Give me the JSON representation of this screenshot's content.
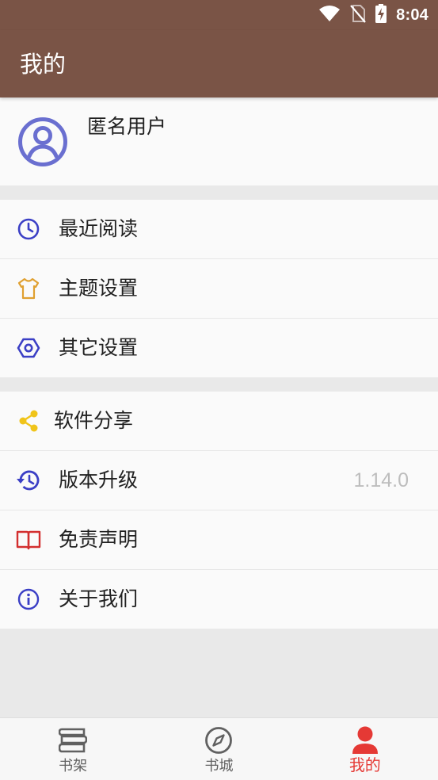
{
  "status_bar": {
    "time": "8:04",
    "icons": [
      "wifi-icon",
      "no-sim-icon",
      "battery-charging-icon"
    ]
  },
  "app_bar": {
    "title": "我的"
  },
  "profile": {
    "username": "匿名用户",
    "avatar_icon": "account-circle-icon"
  },
  "menu_group_1": [
    {
      "label": "最近阅读",
      "icon": "clock-icon",
      "color": "#3b3fc5"
    },
    {
      "label": "主题设置",
      "icon": "tshirt-icon",
      "color": "#e0a030"
    },
    {
      "label": "其它设置",
      "icon": "hexagon-settings-icon",
      "color": "#3b3fc5"
    }
  ],
  "menu_group_2": [
    {
      "label": "软件分享",
      "icon": "share-icon",
      "color": "#f0c419"
    },
    {
      "label": "版本升级",
      "icon": "history-icon",
      "color": "#3b3fc5",
      "value": "1.14.0"
    },
    {
      "label": "免责声明",
      "icon": "book-open-icon",
      "color": "#d32f2f"
    },
    {
      "label": "关于我们",
      "icon": "info-icon",
      "color": "#3b3fc5"
    }
  ],
  "bottom_nav": [
    {
      "label": "书架",
      "icon": "bookshelf-icon",
      "active": false
    },
    {
      "label": "书城",
      "icon": "compass-icon",
      "active": false
    },
    {
      "label": "我的",
      "icon": "person-icon",
      "active": true
    }
  ],
  "colors": {
    "primary": "#7a5446",
    "accent_active": "#e53935",
    "background": "#e9e9e9",
    "card": "#fafafa",
    "version_text": "#bdbdbd"
  }
}
